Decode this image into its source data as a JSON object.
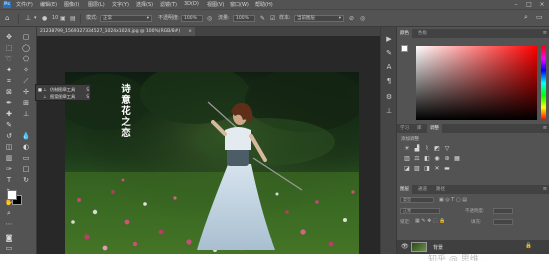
{
  "menubar": {
    "items": [
      "文件(F)",
      "编辑(E)",
      "图像(I)",
      "图层(L)",
      "文字(Y)",
      "选择(S)",
      "滤镜(T)",
      "3D(D)",
      "视图(V)",
      "窗口(W)",
      "帮助(H)"
    ],
    "window_controls": [
      "–",
      "□",
      "×"
    ]
  },
  "options_bar": {
    "mode_label": "模式:",
    "mode_value": "正常",
    "opacity_label": "不透明度:",
    "opacity_value": "100%",
    "flow_label": "流量:",
    "flow_value": "100%",
    "sample_label": "样本:",
    "sample_value": "当前图层"
  },
  "document": {
    "tab_title": "21238799_1569327334527_1024x1024.jpg @ 100%(RGB/8#)",
    "close": "×"
  },
  "tool_flyout": {
    "items": [
      {
        "label": "仿制图章工具",
        "shortcut": "S"
      },
      {
        "label": "图案图章工具",
        "shortcut": "S"
      }
    ]
  },
  "poster_text": {
    "lines": [
      "诗",
      "意",
      "花",
      "之",
      "恋"
    ]
  },
  "panels": {
    "color_tabs": [
      "颜色",
      "色板"
    ],
    "adjust_tabs": [
      "学习",
      "库",
      "调整"
    ],
    "adjust_title": "添加调整",
    "layer_tabs": [
      "图层",
      "通道",
      "路径"
    ],
    "layer_row_labels": [
      "类型",
      "正常",
      "锁定:"
    ],
    "opacity_label": "不透明度:",
    "fill_label": "填充:",
    "background_layer_name": "背景",
    "panel_menu": "≡"
  },
  "watermark": "知乎 @ 思维..."
}
